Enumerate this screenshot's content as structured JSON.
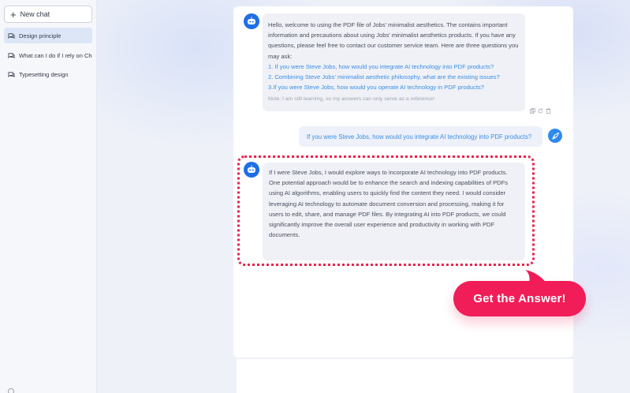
{
  "sidebar": {
    "new_chat_label": "New chat",
    "items": [
      {
        "label": "Design principle",
        "active": true
      },
      {
        "label": "What can I do if I rely on Chat",
        "active": false
      },
      {
        "label": "Typesetting design",
        "active": false
      }
    ]
  },
  "chat": {
    "bot_intro": {
      "text": "Hello, welcome to using the PDF file of Jobs' minimalist aesthetics. The contains important information and precautions about using Jobs' minimalist aesthetics products. If you have any questions, please feel free to contact our customer service team. Here are three questions you may ask:",
      "questions": [
        "1. If you were Steve Jobs, how would you integrate AI technology into PDF products?",
        "2. Combining Steve Jobs' minimalist aesthetic philosophy, what are the existing issues?",
        "3.If you were Steve Jobs, how would you operate AI technology in PDF products?"
      ],
      "note": "Note: I am still learning, so my answers can only serve as a reference!"
    },
    "user_message": "If you were Steve Jobs, how would you integrate AI technology into PDF products?",
    "bot_answer": "If I were Steve Jobs, I would explore ways to incorporate AI technology into PDF products. One potential approach would be to enhance the search and indexing capabilities of PDFs using AI algorithms, enabling users to quickly find the content they need. I  would consider leveraging AI technology to automate document conversion and processing, making it for users to edit, share, and manage PDF files. By integrating AI into PDF products, we could significantly improve the overall user experience and productivity in working with PDF documents."
  },
  "cta": {
    "label": "Get the Answer!"
  },
  "colors": {
    "accent": "#1f6fe5",
    "link": "#3a8ee6",
    "highlight": "#e8234f",
    "cta": "#f01d58"
  }
}
